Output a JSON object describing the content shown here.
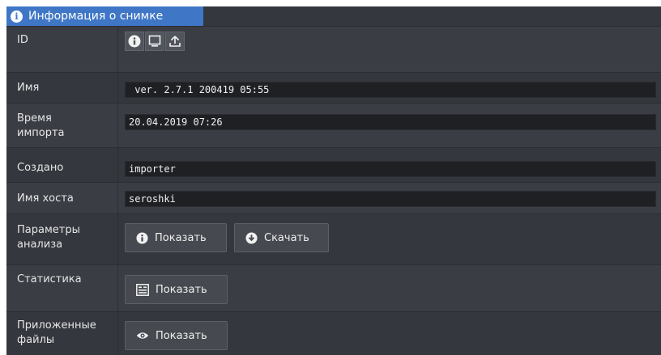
{
  "panel": {
    "tab": {
      "title": "Информация о снимке",
      "icon": "info-icon"
    }
  },
  "rows": {
    "id": {
      "label": "ID",
      "icons": [
        "info-icon",
        "monitor-icon",
        "upload-icon"
      ]
    },
    "name": {
      "label": "Имя",
      "value": " ver. 2.7.1 200419 05:55"
    },
    "import_time": {
      "label": "Время импорта",
      "value": "20.04.2019 07:26"
    },
    "created": {
      "label": "Создано",
      "value": "importer"
    },
    "hostname": {
      "label": "Имя хоста",
      "value": "seroshki"
    },
    "analysis_params": {
      "label": "Параметры анализа",
      "show_label": "Показать",
      "download_label": "Скачать"
    },
    "statistics": {
      "label": "Статистика",
      "show_label": "Показать"
    },
    "attached_files": {
      "label": "Приложенные файлы",
      "show_label": "Показать"
    }
  },
  "colors": {
    "accent": "#3f77c6",
    "panel_bg": "#3a3d44",
    "alt_row_bg": "#34373d",
    "field_bg": "#1e2024"
  }
}
